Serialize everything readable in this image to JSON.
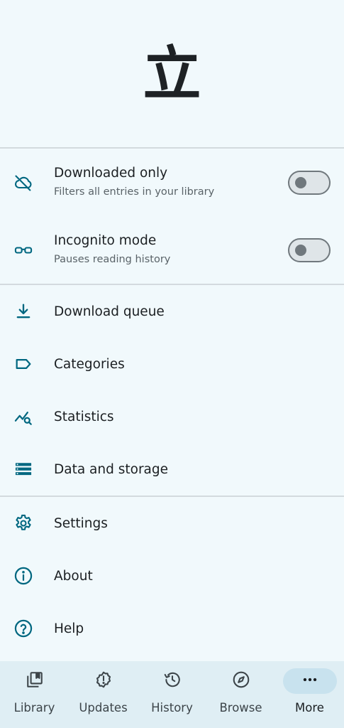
{
  "header": {
    "logo_glyph": "立"
  },
  "toggles": [
    {
      "title": "Downloaded only",
      "subtitle": "Filters all entries in your library",
      "icon": "cloud-off-icon",
      "enabled": false
    },
    {
      "title": "Incognito mode",
      "subtitle": "Pauses reading history",
      "icon": "glasses-icon",
      "enabled": false
    }
  ],
  "menu_group1": [
    {
      "label": "Download queue",
      "icon": "download-icon"
    },
    {
      "label": "Categories",
      "icon": "label-icon"
    },
    {
      "label": "Statistics",
      "icon": "statistics-icon"
    },
    {
      "label": "Data and storage",
      "icon": "storage-icon"
    }
  ],
  "menu_group2": [
    {
      "label": "Settings",
      "icon": "gear-icon"
    },
    {
      "label": "About",
      "icon": "info-icon"
    },
    {
      "label": "Help",
      "icon": "help-icon"
    }
  ],
  "bottom_nav": [
    {
      "label": "Library",
      "icon": "library-icon",
      "active": false
    },
    {
      "label": "Updates",
      "icon": "updates-icon",
      "active": false
    },
    {
      "label": "History",
      "icon": "history-icon",
      "active": false
    },
    {
      "label": "Browse",
      "icon": "compass-icon",
      "active": false
    },
    {
      "label": "More",
      "icon": "more-dots-icon",
      "active": true
    }
  ],
  "colors": {
    "accent": "#006780",
    "background": "#f1f9fc",
    "nav_bg": "#dfeef4",
    "nav_active_pill": "#c8e2ee"
  }
}
